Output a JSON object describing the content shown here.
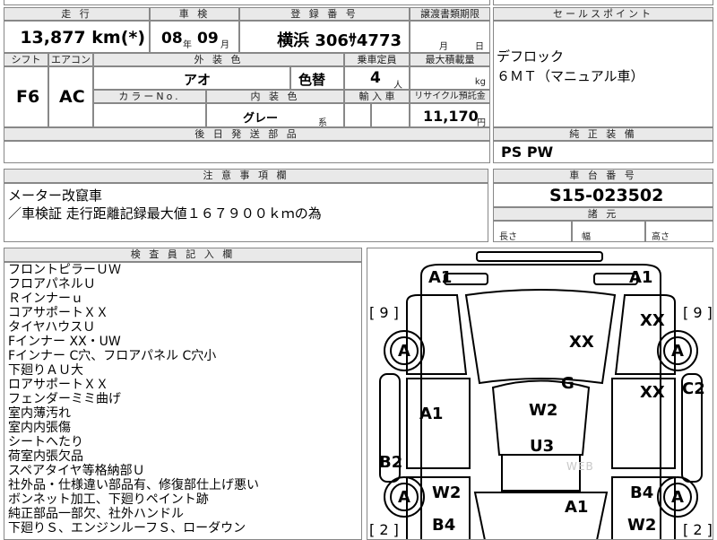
{
  "header": {
    "mileage_label": "走 行",
    "inspection_label": "車 検",
    "registration_label": "登 録 番 号",
    "transfer_label": "譲渡書類期限",
    "sales_point_label": "セールスポイント",
    "shift_label": "シフト",
    "aircon_label": "エアコン",
    "exterior_color_label": "外 装 色",
    "capacity_label": "乗車定員",
    "max_load_label": "最大積載量",
    "color_no_label": "カラーNo.",
    "interior_color_label": "内 装 色",
    "import_label": "輸 入 車",
    "recycle_label": "リサイクル預託金",
    "delivery_parts_label": "後 日 発 送 部 品",
    "genuine_equipment_label": "純 正 装 備",
    "notes_label": "注 意 事 項 欄",
    "chassis_label": "車 台 番 号",
    "dimensions_label": "諸 元",
    "inspector_label": "検 査 員 記 入 欄"
  },
  "vehicle": {
    "mileage": "13,877 km(*)",
    "inspection_year": "08",
    "inspection_year_unit": "年",
    "inspection_month": "09",
    "inspection_month_unit": "月",
    "registration": "横浜 306ｻ4773",
    "transfer_month_unit": "月",
    "transfer_day_unit": "日",
    "shift": "F6",
    "aircon": "AC",
    "exterior_color": "アオ",
    "color_change": "色替",
    "capacity": "4",
    "capacity_unit": "人",
    "max_load_unit": "kg",
    "interior_color": "グレー",
    "interior_color_suffix": "系",
    "recycle_fee": "11,170",
    "recycle_unit": "円",
    "genuine_equipment": "PS PW",
    "chassis_number": "S15-023502",
    "length_label": "長さ",
    "width_label": "幅",
    "height_label": "高さ"
  },
  "sales_points": [
    "デフロック",
    "６ＭＴ（マニュアル車）"
  ],
  "notes": [
    "メーター改竄車",
    "／車検証 走行距離記録最大値１６７９００ｋｍの為"
  ],
  "inspector_remarks": [
    "フロントピラーＵＷ",
    "フロアパネルＵ",
    "Ｒインナーｕ",
    "コアサポートＸＸ",
    "タイヤハウスＵ",
    "Fインナー XX・UW",
    "Fインナー C穴、フロアパネル C穴小",
    "下廻りＡＵ大",
    "ロアサポートＸＸ",
    "フェンダーミミ曲げ",
    "室内薄汚れ",
    "室内内張傷",
    "シートへたり",
    "荷室内張欠品",
    "スペアタイヤ等格納部Ｕ",
    "社外品・仕様違い部品有、修復部仕上げ悪い",
    "ボンネット加工、下廻りペイント跡",
    "純正部品一部欠、社外ハンドル",
    "下廻りＳ、エンジンルーフＳ、ローダウン"
  ],
  "diagram": {
    "labels": [
      "A1",
      "A1",
      "[ 9 ]",
      "[ 9 ]",
      "XX",
      "A",
      "A",
      "XX",
      "G",
      "XX",
      "C2",
      "A1",
      "W2",
      "B2",
      "U3",
      "W2",
      "A",
      "A",
      "B4",
      "A1",
      "B4",
      "W2",
      "[ 2 ]",
      "[ 2 ]"
    ],
    "watermark": "WEB"
  }
}
